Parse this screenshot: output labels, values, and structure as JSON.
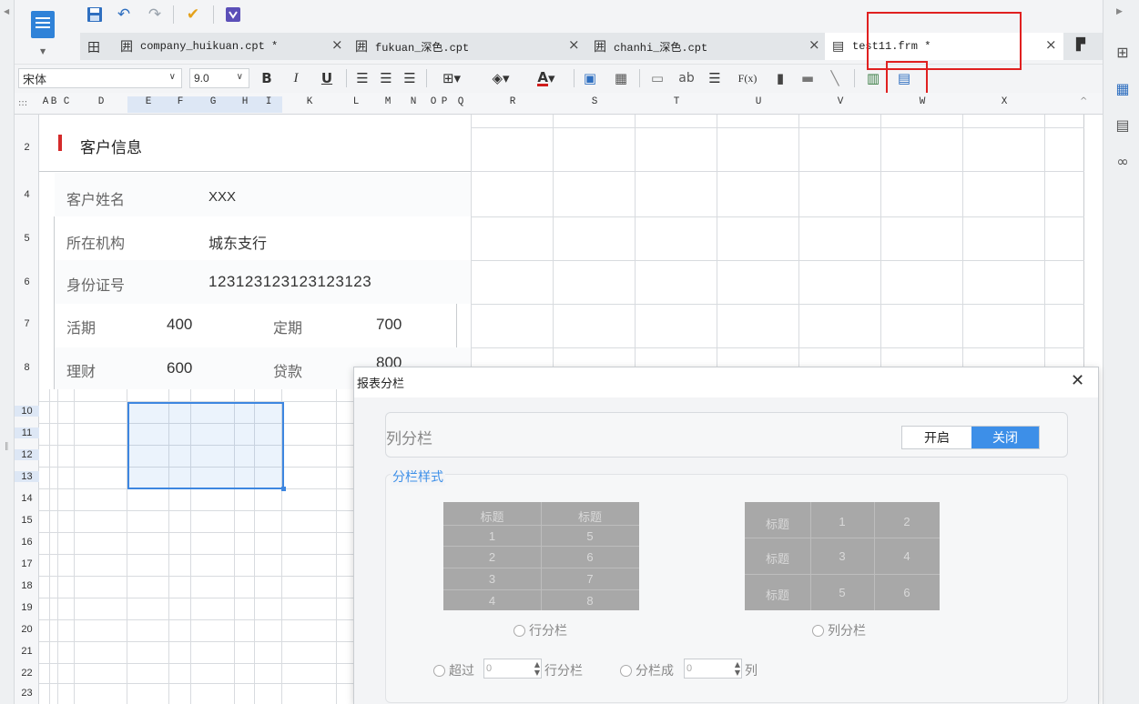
{
  "tabs": [
    {
      "label": "company_huikuan.cpt *"
    },
    {
      "label": "fukuan_深色.cpt"
    },
    {
      "label": "chanhi_深色.cpt"
    },
    {
      "label": "test11.frm *"
    }
  ],
  "toolbar": {
    "font_name": "宋体",
    "font_size": "9.0",
    "bold": "B",
    "italic": "I",
    "underline": "U",
    "text_ab": "ab",
    "formula": "F(x)"
  },
  "columns": [
    "A",
    "B",
    "C",
    "D",
    "E",
    "F",
    "G",
    "H",
    "I",
    "K",
    "L",
    "M",
    "N",
    "O",
    "P",
    "Q",
    "R",
    "S",
    "T",
    "U",
    "V",
    "W",
    "X"
  ],
  "rows": [
    "2",
    "4",
    "5",
    "6",
    "7",
    "8",
    "10",
    "11",
    "12",
    "13",
    "14",
    "15",
    "16",
    "17",
    "18",
    "19",
    "20",
    "21",
    "22",
    "23"
  ],
  "form": {
    "section_title": "客户信息",
    "name_label": "客户姓名",
    "name_value": "XXX",
    "org_label": "所在机构",
    "org_value": "城东支行",
    "id_label": "身份证号",
    "id_value": "123123123123123123",
    "current_label": "活期",
    "current_value": "400",
    "fixed_label": "定期",
    "fixed_value": "700",
    "wealth_label": "理财",
    "wealth_value": "600",
    "loan_label": "贷款",
    "loan_value": "800"
  },
  "dialog": {
    "title": "报表分栏",
    "column_split_label": "列分栏",
    "toggle_on": "开启",
    "toggle_off": "关闭",
    "style_legend": "分栏样式",
    "row_preview": {
      "headers": [
        "标题",
        "标题"
      ],
      "cells": [
        [
          "1",
          "5"
        ],
        [
          "2",
          "6"
        ],
        [
          "3",
          "7"
        ],
        [
          "4",
          "8"
        ]
      ]
    },
    "col_preview": {
      "rows": [
        [
          "标题",
          "1",
          "2"
        ],
        [
          "标题",
          "3",
          "4"
        ],
        [
          "标题",
          "5",
          "6"
        ]
      ]
    },
    "row_split_radio": "行分栏",
    "col_split_radio": "列分栏",
    "exceed_label": "超过",
    "exceed_value": "0",
    "exceed_suffix": "行分栏",
    "split_into_label": "分栏成",
    "split_into_value": "0",
    "split_into_suffix": "列"
  },
  "colors": {
    "accent": "#3d8fe8",
    "highlight": "#e02020",
    "section_marker": "#d42a2a"
  }
}
